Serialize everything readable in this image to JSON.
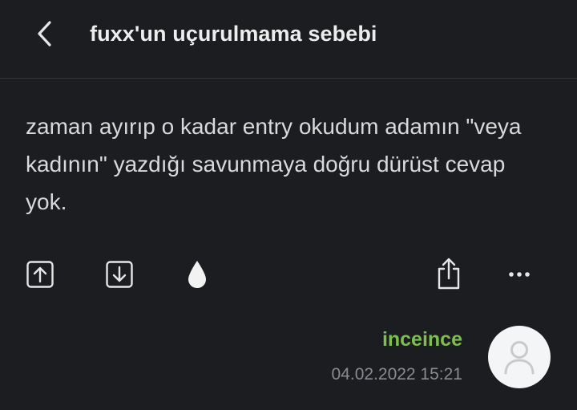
{
  "header": {
    "back_icon": "chevron-left-icon",
    "title": "fuxx'un uçurulmama sebebi"
  },
  "entry": {
    "text": "zaman ayırıp o kadar entry okudum adamın \"veya kadının\" yazdığı savunmaya doğru dürüst cevap yok."
  },
  "actions": {
    "upvote_icon": "arrow-up-box-icon",
    "downvote_icon": "arrow-down-box-icon",
    "drop_icon": "drop-icon",
    "share_icon": "share-icon",
    "more_icon": "more-icon"
  },
  "meta": {
    "author": "inceince",
    "date": "04.02.2022 15:21",
    "author_color": "#7cbf4f",
    "avatar_icon": "user-icon"
  }
}
